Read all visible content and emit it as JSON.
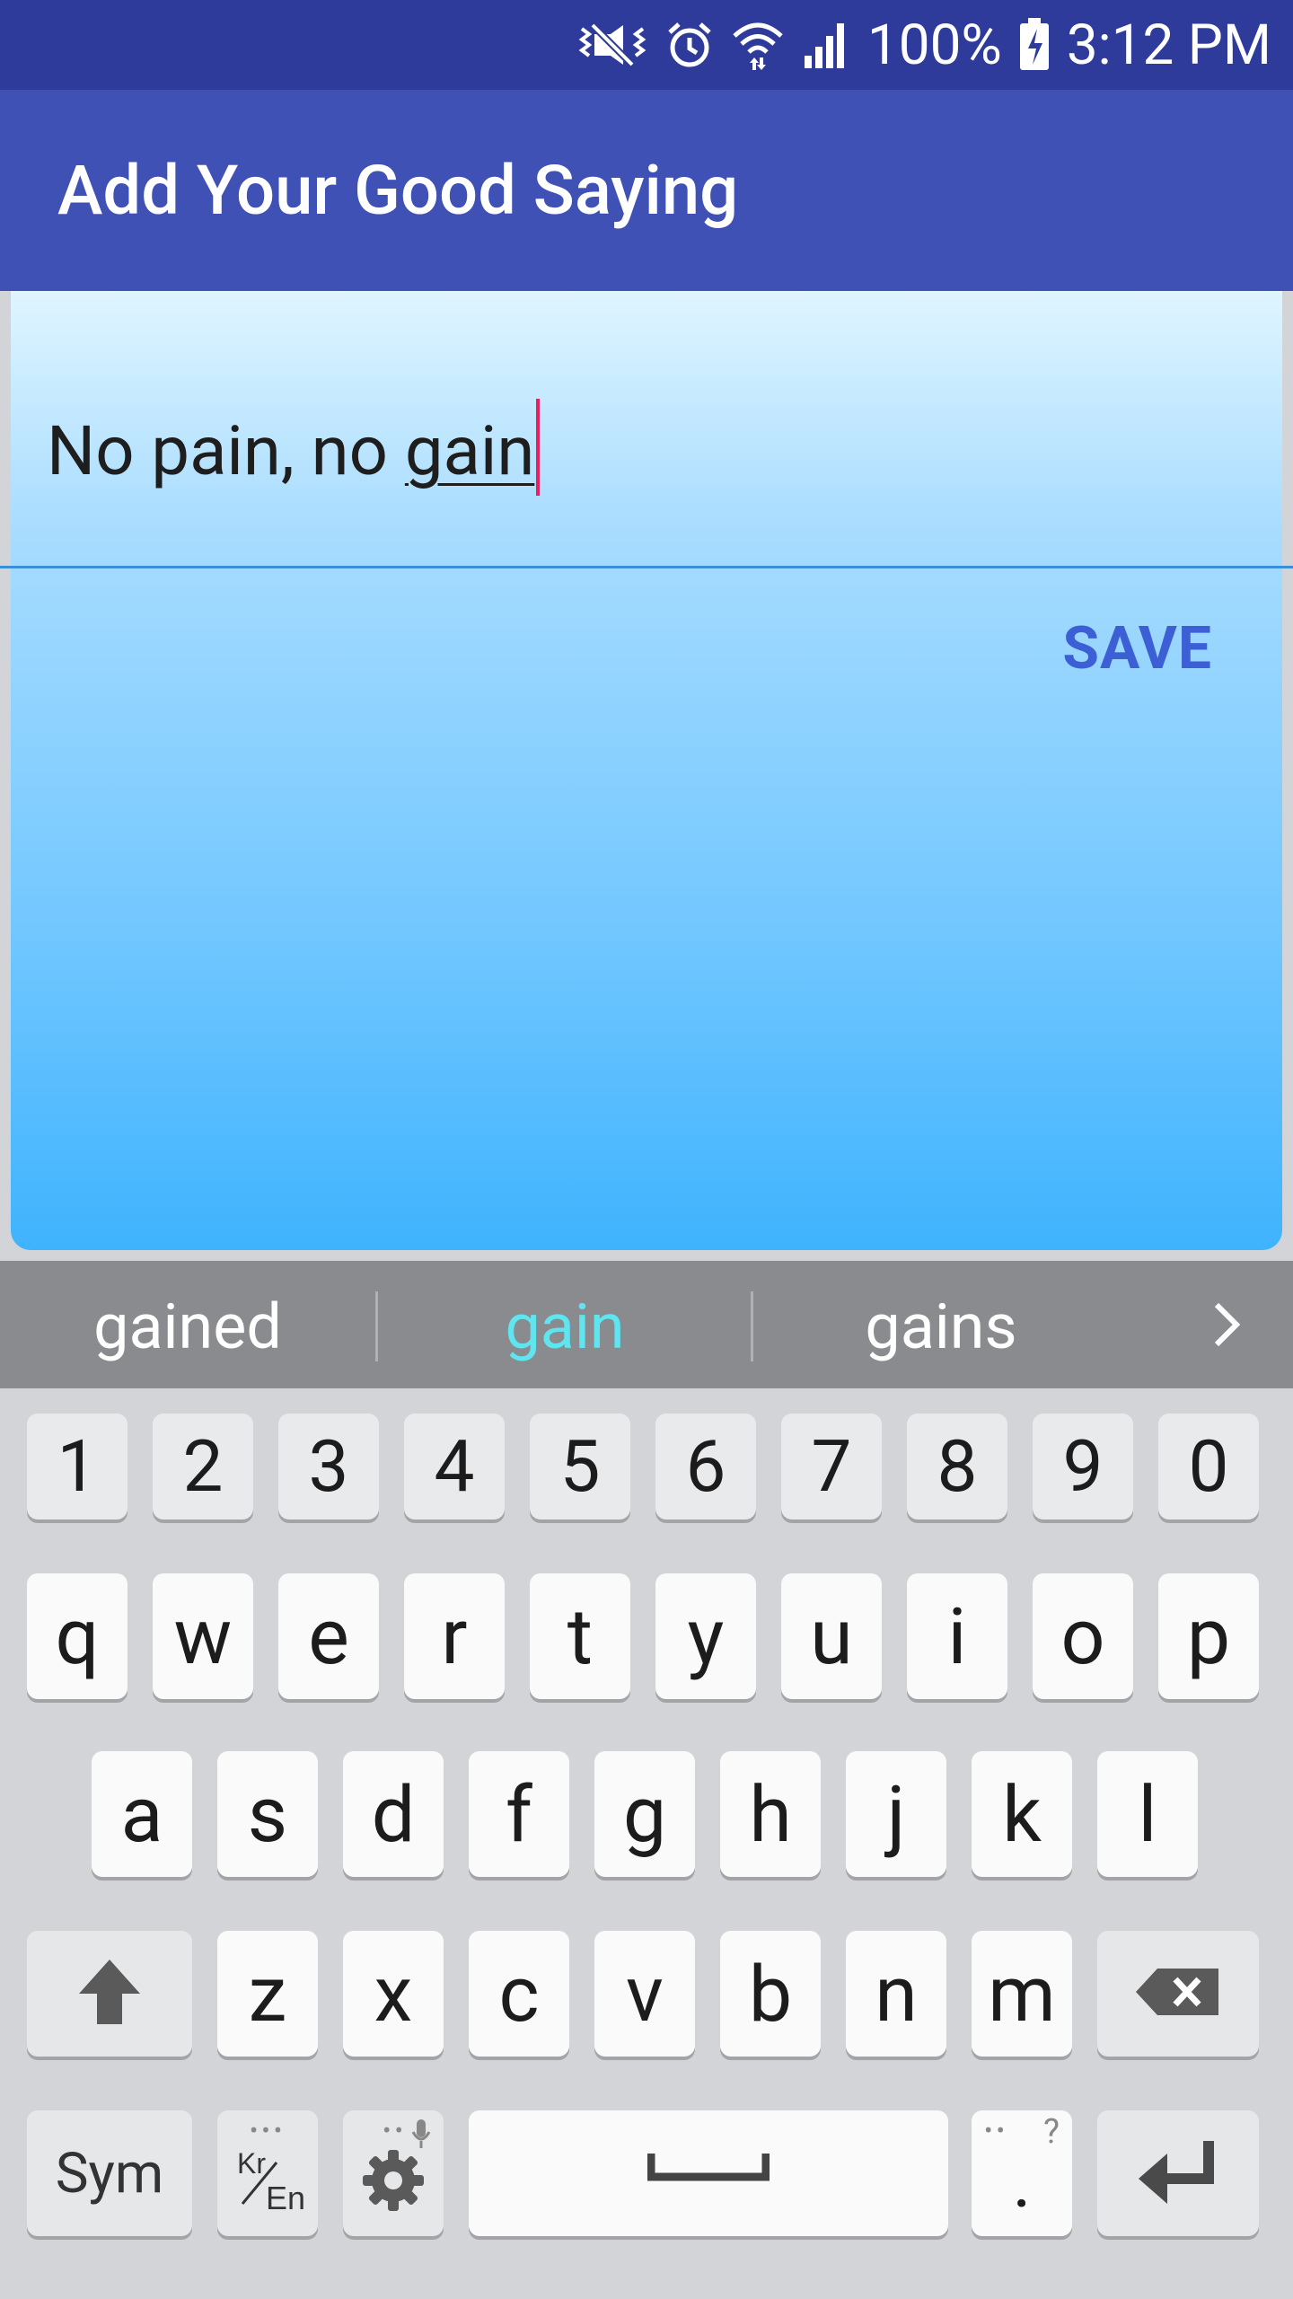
{
  "status_bar": {
    "battery": "100%",
    "time": "3:12 PM"
  },
  "app_bar": {
    "title": "Add Your Good Saying"
  },
  "editor": {
    "text_before": "No pain, no ",
    "text_composing": "gain"
  },
  "save_label": "SAVE",
  "suggestions": [
    "gained",
    "gain",
    "gains"
  ],
  "keyboard": {
    "numbers": [
      "1",
      "2",
      "3",
      "4",
      "5",
      "6",
      "7",
      "8",
      "9",
      "0"
    ],
    "row1": [
      "q",
      "w",
      "e",
      "r",
      "t",
      "y",
      "u",
      "i",
      "o",
      "p"
    ],
    "row2": [
      "a",
      "s",
      "d",
      "f",
      "g",
      "h",
      "j",
      "k",
      "l"
    ],
    "row3": [
      "z",
      "x",
      "c",
      "v",
      "b",
      "n",
      "m"
    ],
    "sym_label": "Sym",
    "lang_top": "Kr",
    "lang_bottom": "En",
    "period": ".",
    "period_hint": "?"
  },
  "icons": {
    "status": [
      "vibrate-icon",
      "alarm-icon",
      "wifi-icon",
      "signal-icon",
      "battery-charging-icon"
    ],
    "keys": [
      "shift-icon",
      "backspace-icon",
      "settings-icon",
      "mic-icon",
      "space-icon",
      "enter-icon",
      "chevron-right-icon"
    ]
  },
  "colors": {
    "status_bar": "#2f3b9a",
    "app_bar": "#3f51b5",
    "accent": "#3c5fd6",
    "cursor": "#e91e63",
    "suggest_highlight": "#5fe5ef"
  }
}
